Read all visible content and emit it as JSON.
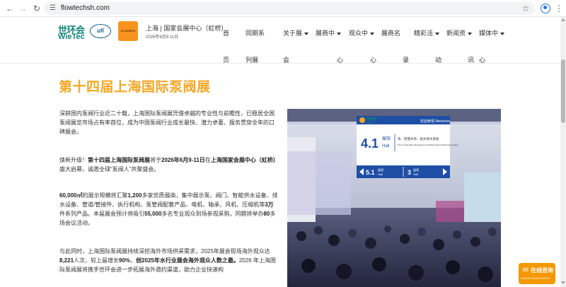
{
  "browser": {
    "url": "flowtechsh.com"
  },
  "header": {
    "logo_cn": "世环会",
    "logo_en": "WieTec",
    "ufi_mark": "ufi",
    "fluitech_mark": "FLUITECH",
    "venue": "上海 | 国家会展中心（虹桥）",
    "date": "2026年6月9-11日"
  },
  "nav": [
    {
      "line1": "首",
      "line2": "页",
      "dropdown": false
    },
    {
      "line1": "同期系",
      "line2": "列展",
      "dropdown": false
    },
    {
      "line1": "关于展",
      "line2": "会",
      "dropdown": true
    },
    {
      "line1": "展商中",
      "line2": "心",
      "dropdown": true
    },
    {
      "line1": "观众中",
      "line2": "心",
      "dropdown": true
    },
    {
      "line1": "展商名",
      "line2": "录",
      "dropdown": false
    },
    {
      "line1": "精彩活",
      "line2": "动",
      "dropdown": true
    },
    {
      "line1": "新闻资",
      "line2": "讯",
      "dropdown": true
    },
    {
      "line1": "媒体中",
      "line2": "心",
      "dropdown": true
    }
  ],
  "main": {
    "title": "第十四届上海国际泵阀展",
    "p1": "深耕国内泵阀行业近二十载，上海国际泵阀展凭借卓越的专业性与前瞻性，已稳居全国泵阀展览市场占有率首位，成为中国泵阀行业成长最快、潜力卓著、服务贯穿全年的口碑展会。",
    "p2_a": "焕新升级！",
    "p2_b": "第十四届上海国际泵阀展",
    "p2_c": "将于",
    "p2_d": "2026年6月9-11日",
    "p2_e": "在",
    "p2_f": "上海国家会展中心（虹桥）",
    "p2_g": "盛大启幕，诚邀全球“泵阀人”共聚盛会。",
    "p3_a": "60,000㎡",
    "p3_b": "的展示规模将汇聚",
    "p3_c": "1,200",
    "p3_d": "多家优质展商，集中展示泵、阀门、智能供水设备、排水设备、管道/管接件、执行机构、泵管阀配套产品、电机、轴承、风机、压缩机等",
    "p3_e": "3万",
    "p3_f": "件系列产品。本届展会预计将吸引",
    "p3_g": "55,000",
    "p3_h": "多名专业观众到场参观采购，同期将举办",
    "p3_i": "80",
    "p3_j": "多场会议活动。",
    "p4_a": "与此同时，上海国际泵阀展持续深挖海外市场供采需求，2025年展会现场海外观众达",
    "p4_b": "8,221",
    "p4_c": "人次，较上届增长",
    "p4_d": "90%",
    "p4_e": "，",
    "p4_f": "创2025年水行业展会海外观众人数之最。",
    "p4_g": "2026 年上海国际泵阀展将携手世环会进一步拓展海外邀约渠道，助力企业快速构"
  },
  "photo": {
    "brand_cn": "世环会",
    "brand_en": "WieTec",
    "welcome": "欢迎参观  Welcome",
    "hall_num": "4.1",
    "hall_cn": "展馆",
    "hall_en": "Hall",
    "hall_desc_cn": "泵、智慧水务、给水排水系统",
    "hall_desc_en": "Pump, Smart Water Management and Water Supply and Drainage System",
    "sign_left_num": "5.1",
    "sign_left_cn": "展馆",
    "sign_left_en": "Hall",
    "sign_right_num": "3",
    "sign_right_cn": "展馆",
    "sign_right_en": "Hall"
  },
  "consult": {
    "cn": "在线咨询",
    "en": "ONLINE CONSULTATION"
  },
  "colors": {
    "title_orange": "#f5a623",
    "brand_teal": "#14857b",
    "sign_blue": "#1e4fa5",
    "consult_orange": "#f39800"
  }
}
